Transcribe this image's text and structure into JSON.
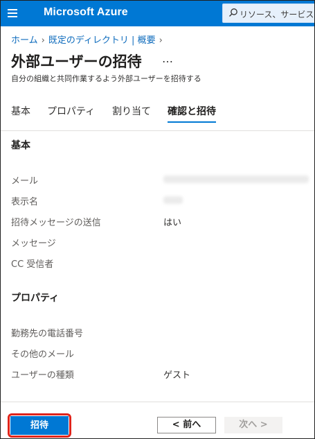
{
  "app": {
    "brand": "Microsoft Azure"
  },
  "search": {
    "placeholder": "リソース、サービス、ド"
  },
  "breadcrumb": {
    "items": [
      "ホーム",
      "既定のディレクトリ | 概要"
    ]
  },
  "page": {
    "title": "外部ユーザーの招待",
    "more": "…",
    "subtitle": "自分の組織と共同作業するよう外部ユーザーを招待する"
  },
  "tabs": [
    "基本",
    "プロパティ",
    "割り当て",
    "確認と招待"
  ],
  "active_tab": "確認と招待",
  "review": {
    "basics": {
      "heading": "基本",
      "fields": [
        {
          "label": "メール",
          "value": ""
        },
        {
          "label": "表示名",
          "value": ""
        },
        {
          "label": "招待メッセージの送信",
          "value": "はい"
        },
        {
          "label": "メッセージ",
          "value": ""
        },
        {
          "label": "CC 受信者",
          "value": ""
        }
      ]
    },
    "properties": {
      "heading": "プロパティ",
      "fields": [
        {
          "label": "勤務先の電話番号",
          "value": ""
        },
        {
          "label": "その他のメール",
          "value": ""
        },
        {
          "label": "ユーザーの種類",
          "value": "ゲスト"
        }
      ]
    }
  },
  "footer": {
    "invite_label": "招待",
    "prev_label": "< 前へ",
    "next_label": "次へ >"
  },
  "colors": {
    "accent": "#0078d4",
    "highlight": "#e0241b"
  },
  "icons": {
    "menu": "hamburger-icon",
    "search": "search-icon"
  }
}
